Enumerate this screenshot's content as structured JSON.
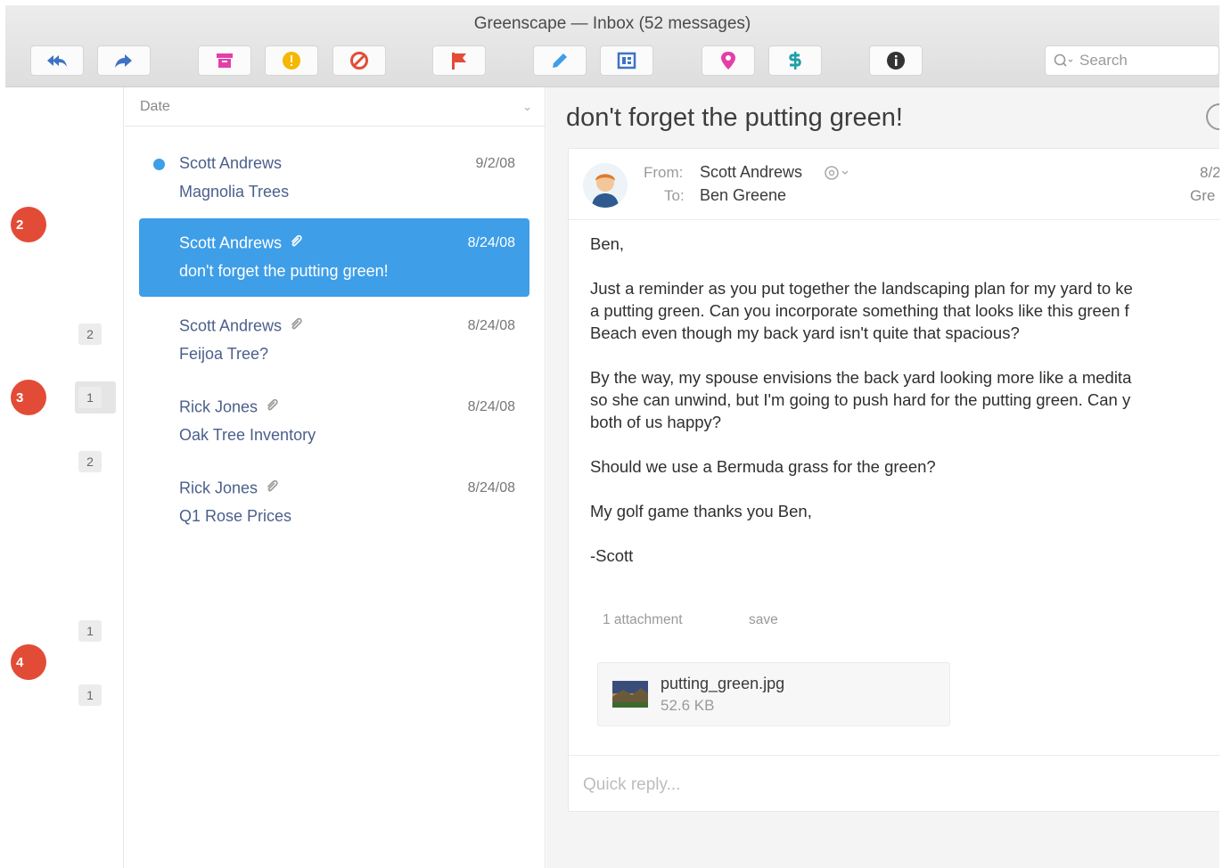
{
  "window": {
    "title": "Greenscape — Inbox (52 messages)"
  },
  "toolbar": {
    "buttons": [
      {
        "name": "reply-all-button",
        "icon": "reply-all-icon"
      },
      {
        "name": "forward-button",
        "icon": "forward-arrow-icon"
      },
      {
        "name": "archive-button",
        "icon": "archive-box-icon"
      },
      {
        "name": "junk-button",
        "icon": "exclamation-circle-icon"
      },
      {
        "name": "block-button",
        "icon": "prohibited-icon"
      },
      {
        "name": "flag-button",
        "icon": "flag-icon"
      },
      {
        "name": "compose-button",
        "icon": "pencil-icon"
      },
      {
        "name": "address-book-button",
        "icon": "address-card-icon"
      },
      {
        "name": "location-button",
        "icon": "map-pin-icon"
      },
      {
        "name": "money-button",
        "icon": "dollar-sign-icon"
      },
      {
        "name": "info-button",
        "icon": "info-icon"
      }
    ],
    "search": {
      "placeholder": "Search"
    },
    "colors": {
      "accent": "#3e9ee8",
      "red": "#e24c37",
      "yellow": "#f5b700",
      "pink": "#e33fa8",
      "teal": "#1f9fa8"
    }
  },
  "sidebar": {
    "steps": [
      "2",
      "3",
      "4"
    ],
    "counts": [
      "2",
      "1",
      "2",
      "1",
      "1"
    ]
  },
  "message_list": {
    "sort_label": "Date",
    "messages": [
      {
        "from": "Scott Andrews",
        "subject": "Magnolia Trees",
        "date": "9/2/08",
        "unread": true,
        "attachment": false,
        "selected": false
      },
      {
        "from": "Scott Andrews",
        "subject": "don't forget the putting green!",
        "date": "8/24/08",
        "unread": false,
        "attachment": true,
        "selected": true
      },
      {
        "from": "Scott Andrews",
        "subject": "Feijoa Tree?",
        "date": "8/24/08",
        "unread": false,
        "attachment": true,
        "selected": false
      },
      {
        "from": "Rick Jones",
        "subject": "Oak Tree Inventory",
        "date": "8/24/08",
        "unread": false,
        "attachment": true,
        "selected": false
      },
      {
        "from": "Rick Jones",
        "subject": "Q1 Rose Prices",
        "date": "8/24/08",
        "unread": false,
        "attachment": true,
        "selected": false
      }
    ]
  },
  "reader": {
    "subject": "don't forget the putting green!",
    "from_label": "From:",
    "from": "Scott Andrews",
    "to_label": "To:",
    "to": "Ben Greene",
    "date_cut": "8/2",
    "name_cut": "Gre",
    "body": [
      "Ben,",
      "Just a reminder as you put together the landscaping plan for my yard to ke\na putting green. Can you incorporate something that looks like this green f\nBeach even though my back yard isn't quite that spacious?",
      "By the way, my spouse envisions the back yard looking more like a medita\nso she can unwind, but I'm going to push hard for the putting green. Can y\nboth of us happy?",
      "Should we use a Bermuda grass for the green?",
      "My golf game thanks you Ben,",
      "-Scott"
    ],
    "attachments_label": "1 attachment",
    "save_label": "save",
    "attachment": {
      "filename": "putting_green.jpg",
      "size": "52.6 KB"
    },
    "quick_reply_placeholder": "Quick reply..."
  }
}
